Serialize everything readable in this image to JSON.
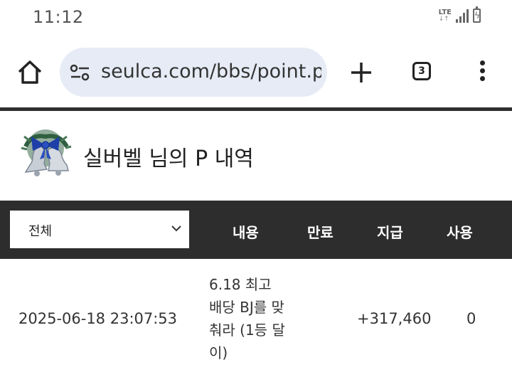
{
  "status_bar": {
    "time": "11:12",
    "network": "LTE"
  },
  "browser": {
    "url": "seulca.com/bbs/point.p",
    "tab_count": "3",
    "icons": [
      "home-icon",
      "site-settings-icon",
      "plus-icon",
      "tabs-icon",
      "more-vert-icon"
    ]
  },
  "header": {
    "title": "실버벨 님의 P 내역"
  },
  "table": {
    "filter_value": "전체",
    "columns": {
      "content": "내용",
      "expire": "만료",
      "earned": "지급",
      "used": "사용"
    },
    "rows": [
      {
        "datetime": "2025-06-18 23:07:53",
        "description": "6.18 최고 배당 BJ를 맞춰라 (1등 달이)",
        "earned": "+317,460",
        "used": "0"
      }
    ]
  }
}
